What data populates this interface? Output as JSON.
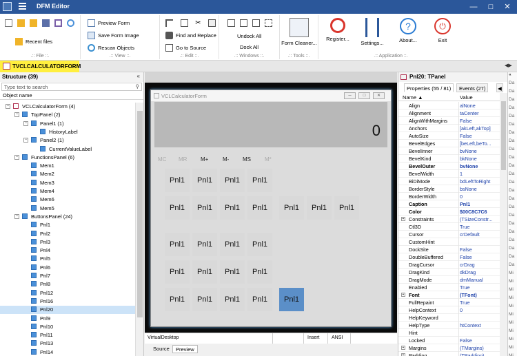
{
  "window": {
    "title": "DFM Editor"
  },
  "ribbon": {
    "file": {
      "recent": "Recent files",
      "label": ".:: File ::."
    },
    "view": {
      "preview_form": "Preview Form",
      "save_image": "Save Form Image",
      "rescan": "Rescan Objects",
      "label": ".:: View ::."
    },
    "edit": {
      "find_replace": "Find and Replace",
      "goto_source": "Go to Source",
      "label": ".:: Edit ::."
    },
    "windows": {
      "undock_all": "Undock All",
      "dock_all": "Dock All",
      "label": ".:: Windows ::."
    },
    "tools": {
      "form_cleaner": "Form Cleaner...",
      "label": ".:: Tools ::."
    },
    "application": {
      "register": "Register...",
      "settings": "Settings...",
      "about": "About...",
      "exit": "Exit",
      "label": ".:: Application ::."
    }
  },
  "doc_tab": "TVCLCALCULATORFORM",
  "structure": {
    "header": "Structure (39)",
    "search_placeholder": "Type text to search",
    "column": "Object name",
    "nodes": [
      {
        "label": "VCLCalculatorForm (4)"
      },
      {
        "label": "TopPanel (2)"
      },
      {
        "label": "Panel1 (1)"
      },
      {
        "label": "HistoryLabel"
      },
      {
        "label": "Panel2 (1)"
      },
      {
        "label": "CurrentValueLabel"
      },
      {
        "label": "FunctionsPanel (6)"
      },
      {
        "label": "Mem1"
      },
      {
        "label": "Mem2"
      },
      {
        "label": "Mem3"
      },
      {
        "label": "Mem4"
      },
      {
        "label": "Mem6"
      },
      {
        "label": "Mem5"
      },
      {
        "label": "ButtonsPanel (24)"
      },
      {
        "label": "Pnl1"
      },
      {
        "label": "Pnl2"
      },
      {
        "label": "Pnl3"
      },
      {
        "label": "Pnl4"
      },
      {
        "label": "Pnl5"
      },
      {
        "label": "Pnl6"
      },
      {
        "label": "Pnl7"
      },
      {
        "label": "Pnl8"
      },
      {
        "label": "Pnl12"
      },
      {
        "label": "Pnl16"
      },
      {
        "label": "Pnl20"
      },
      {
        "label": "Pnl9"
      },
      {
        "label": "Pnl10"
      },
      {
        "label": "Pnl11"
      },
      {
        "label": "Pnl13"
      },
      {
        "label": "Pnl14"
      }
    ]
  },
  "form": {
    "title": "VCLCalculatorForm",
    "display_value": "0",
    "memory": [
      "MC",
      "MR",
      "M+",
      "M-",
      "MS",
      "M*"
    ],
    "button_label": "Pnl1",
    "active_button_label": "Pnl1"
  },
  "design_status": {
    "desktop": "VirtualDesktop",
    "mode": "Insert",
    "encoding": "ANSI"
  },
  "source_tabs": {
    "source": "Source",
    "preview": "Preview"
  },
  "inspector": {
    "header": "Pnl20: TPanel",
    "tab_properties": "Properties (55 / 81)",
    "tab_events": "Events (27)",
    "col_name": "Name",
    "col_value": "Value",
    "rows": [
      {
        "n": "Align",
        "v": "alNone"
      },
      {
        "n": "Alignment",
        "v": "taCenter"
      },
      {
        "n": "AlignWithMargins",
        "v": "False"
      },
      {
        "n": "Anchors",
        "v": "[akLeft,akTop]"
      },
      {
        "n": "AutoSize",
        "v": "False"
      },
      {
        "n": "BevelEdges",
        "v": "[beLeft,beTo..."
      },
      {
        "n": "BevelInner",
        "v": "bvNone"
      },
      {
        "n": "BevelKind",
        "v": "bkNone"
      },
      {
        "n": "BevelOuter",
        "v": "bvNone"
      },
      {
        "n": "BevelWidth",
        "v": "1"
      },
      {
        "n": "BiDiMode",
        "v": "bdLeftToRight"
      },
      {
        "n": "BorderStyle",
        "v": "bsNone"
      },
      {
        "n": "BorderWidth",
        "v": "0"
      },
      {
        "n": "Caption",
        "v": "Pnl1"
      },
      {
        "n": "Color",
        "v": "$00C8C7C6"
      },
      {
        "n": "Constraints",
        "v": "(TSizeConstr..."
      },
      {
        "n": "Ctl3D",
        "v": "True"
      },
      {
        "n": "Cursor",
        "v": "crDefault"
      },
      {
        "n": "CustomHint",
        "v": ""
      },
      {
        "n": "DockSite",
        "v": "False"
      },
      {
        "n": "DoubleBuffered",
        "v": "False"
      },
      {
        "n": "DragCursor",
        "v": "crDrag"
      },
      {
        "n": "DragKind",
        "v": "dkDrag"
      },
      {
        "n": "DragMode",
        "v": "dmManual"
      },
      {
        "n": "Enabled",
        "v": "True"
      },
      {
        "n": "Font",
        "v": "(TFont)"
      },
      {
        "n": "FullRepaint",
        "v": "True"
      },
      {
        "n": "HelpContext",
        "v": "0"
      },
      {
        "n": "HelpKeyword",
        "v": ""
      },
      {
        "n": "HelpType",
        "v": "htContext"
      },
      {
        "n": "Hint",
        "v": ""
      },
      {
        "n": "Locked",
        "v": "False"
      },
      {
        "n": "Margins",
        "v": "(TMargins)"
      },
      {
        "n": "Padding",
        "v": "(TPadding)"
      }
    ]
  },
  "strip": [
    "Da",
    "Da",
    "Da",
    "Da",
    "Da",
    "Da",
    "Da",
    "Da",
    "Da",
    "Da",
    "Da",
    "Da",
    "Da",
    "Da",
    "Da",
    "Da",
    "Da",
    "Da",
    "Da",
    "Da",
    "Da",
    "Da",
    "Da",
    "Mi",
    "Mi",
    "Mi",
    "Mi",
    "Mi",
    "Mi",
    "Mi",
    "Mi",
    "Mi",
    "Mi",
    "Mi"
  ],
  "colors": {
    "titlebar": "#2b579a",
    "doc_tab": "#ffef3f",
    "selection": "#cce3f8",
    "active_button": "#5b8fc8"
  }
}
